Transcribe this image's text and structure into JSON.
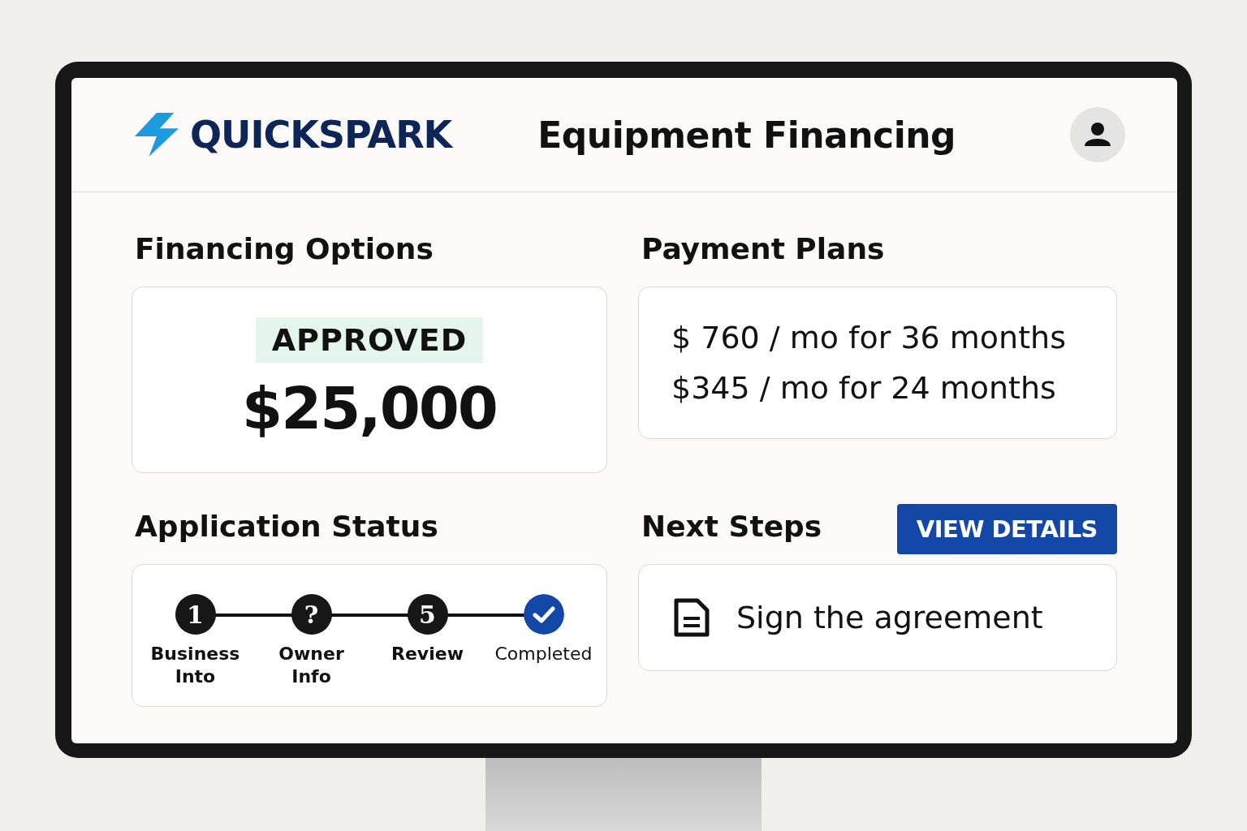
{
  "header": {
    "brand": "QUICKSPARK",
    "title": "Equipment Financing"
  },
  "financing": {
    "heading": "Financing Options",
    "badge": "APPROVED",
    "amount": "$25,000"
  },
  "payment_plans": {
    "heading": "Payment Plans",
    "plans": [
      "$ 760 / mo for 36 months",
      "$345 / mo for 24 months"
    ]
  },
  "application_status": {
    "heading": "Application Status",
    "steps": [
      {
        "kind": "number",
        "marker": "1",
        "label": "Business Into"
      },
      {
        "kind": "number",
        "marker": "?",
        "label": "Owner Info"
      },
      {
        "kind": "number",
        "marker": "5",
        "label": "Review"
      },
      {
        "kind": "done",
        "label": "Completed"
      }
    ]
  },
  "next_steps": {
    "heading": "Next Steps",
    "button": "VIEW DETAILS",
    "task": "Sign the agreement"
  }
}
